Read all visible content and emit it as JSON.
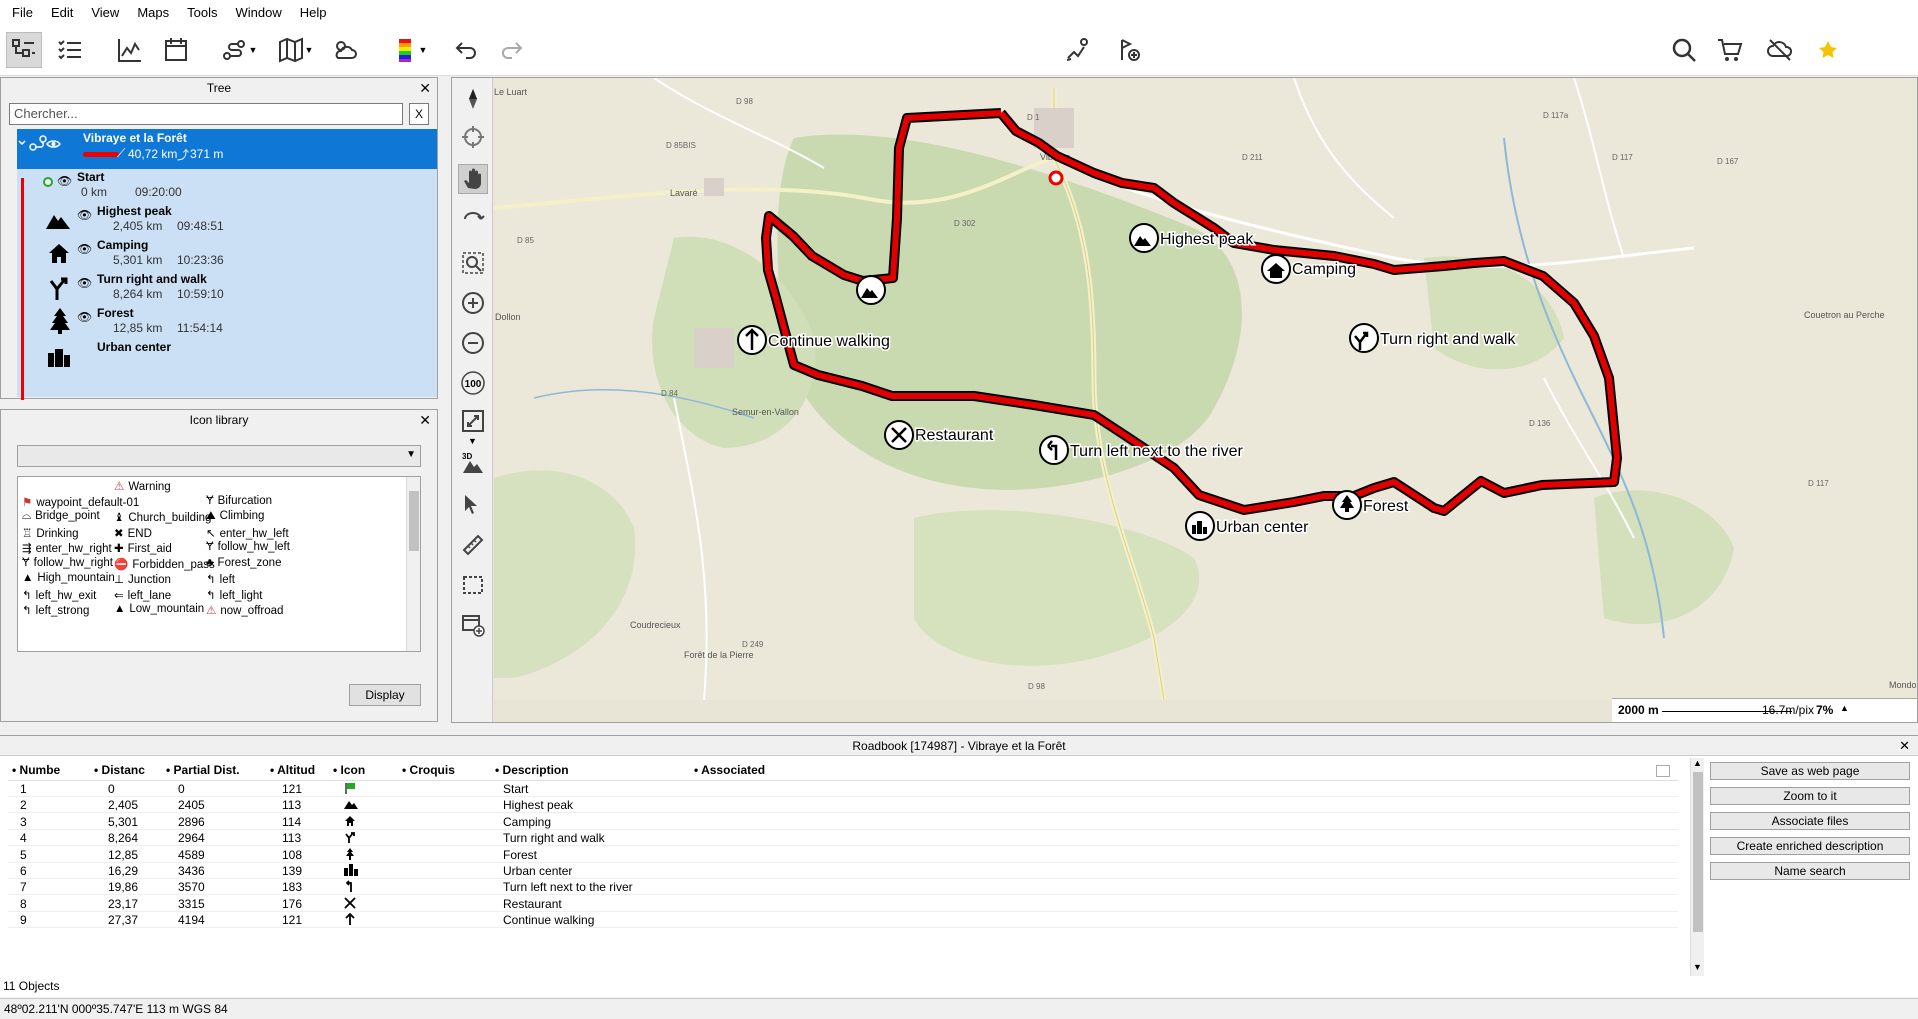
{
  "menu": [
    "File",
    "Edit",
    "View",
    "Maps",
    "Tools",
    "Window",
    "Help"
  ],
  "tree": {
    "title": "Tree",
    "search_placeholder": "Chercher...",
    "search_clear": "X",
    "track": {
      "name": "Vibraye et la Forêt",
      "distance": "40,72 km",
      "elevation": "371 m"
    },
    "items": [
      {
        "name": "Start",
        "dist": "0 km",
        "time": "09:20:00"
      },
      {
        "name": "Highest peak",
        "dist": "2,405 km",
        "time": "09:48:51"
      },
      {
        "name": "Camping",
        "dist": "5,301 km",
        "time": "10:23:36"
      },
      {
        "name": "Turn right and walk",
        "dist": "8,264 km",
        "time": "10:59:10"
      },
      {
        "name": "Forest",
        "dist": "12,85 km",
        "time": "11:54:14"
      },
      {
        "name": "Urban center",
        "dist": "",
        "time": ""
      }
    ]
  },
  "icon_library": {
    "title": "Icon library",
    "display_button": "Display",
    "icons": [
      [
        "",
        "Warning",
        ""
      ],
      [
        "waypoint_default-01",
        "",
        "Bifurcation"
      ],
      [
        "Bridge_point",
        "Church_building",
        "Climbing"
      ],
      [
        "Drinking",
        "END",
        "enter_hw_left"
      ],
      [
        "enter_hw_right",
        "First_aid",
        "follow_hw_left"
      ],
      [
        "follow_hw_right",
        "Forbidden_pass",
        "Forest_zone"
      ],
      [
        "High_mountain",
        "Junction",
        "left"
      ],
      [
        "left_hw_exit",
        "left_lane",
        "left_light"
      ],
      [
        "left_strong",
        "Low_mountain",
        "now_offroad"
      ]
    ]
  },
  "map": {
    "towns": [
      "Le Luart",
      "Vibraye",
      "Lavaré",
      "Dollon",
      "Semur-en-Vallon",
      "Coudrecieux",
      "Forêt de la Pierre",
      "Coudrecieux",
      "Couetron au Perche",
      "Mondoubleau"
    ],
    "roads": [
      "D 98",
      "D 1",
      "D 85BIS",
      "D 302",
      "D 85",
      "D 84",
      "D 211",
      "D 117",
      "D 167",
      "D 117a",
      "D 136",
      "D 249",
      "D 117",
      "D 98"
    ],
    "waypoints": [
      {
        "label": "Highest peak"
      },
      {
        "label": "Camping"
      },
      {
        "label": "Turn right and walk"
      },
      {
        "label": "Continue walking"
      },
      {
        "label": "Restaurant"
      },
      {
        "label": "Turn left next to the river"
      },
      {
        "label": "Urban center"
      },
      {
        "label": "Forest"
      }
    ],
    "scale_text": "2000 m",
    "resolution": "16.7m/pix",
    "zoom": "7%"
  },
  "roadbook": {
    "title": "Roadbook [174987] - Vibraye et la Forêt",
    "headers": [
      "Number",
      "Distance",
      "Partial Dist.",
      "Altitude",
      "Icon",
      "Croquis",
      "Description",
      "Associated"
    ],
    "header_display": [
      "Numbe",
      "Distanc",
      "Partial Dist.",
      "Altitud",
      "Icon",
      "Croquis",
      "Description",
      "Associated"
    ],
    "rows": [
      {
        "n": "1",
        "dist": "0",
        "partial": "0",
        "alt": "121",
        "icon": "flag",
        "desc": "Start"
      },
      {
        "n": "2",
        "dist": "2,405",
        "partial": "2405",
        "alt": "113",
        "icon": "mountain",
        "desc": "Highest peak"
      },
      {
        "n": "3",
        "dist": "5,301",
        "partial": "2896",
        "alt": "114",
        "icon": "house",
        "desc": "Camping"
      },
      {
        "n": "4",
        "dist": "8,264",
        "partial": "2964",
        "alt": "113",
        "icon": "fork",
        "desc": "Turn right and walk"
      },
      {
        "n": "5",
        "dist": "12,85",
        "partial": "4589",
        "alt": "108",
        "icon": "tree",
        "desc": "Forest"
      },
      {
        "n": "6",
        "dist": "16,29",
        "partial": "3436",
        "alt": "139",
        "icon": "building",
        "desc": "Urban center"
      },
      {
        "n": "7",
        "dist": "19,86",
        "partial": "3570",
        "alt": "183",
        "icon": "turn-left",
        "desc": "Turn left next to the river"
      },
      {
        "n": "8",
        "dist": "23,17",
        "partial": "3315",
        "alt": "176",
        "icon": "cutlery",
        "desc": "Restaurant"
      },
      {
        "n": "9",
        "dist": "27,37",
        "partial": "4194",
        "alt": "121",
        "icon": "arrow-up",
        "desc": "Continue walking"
      }
    ],
    "buttons": [
      "Save as web page",
      "Zoom to it",
      "Associate files",
      "Create enriched description",
      "Name search"
    ],
    "object_count": "11 Objects"
  },
  "status": "48º02.211'N 000º35.747'E  113 m  WGS 84",
  "colors": {
    "track": "#e00000",
    "selection": "#0f78d7",
    "selection_light": "#cce0f5",
    "star": "#f5c400"
  }
}
